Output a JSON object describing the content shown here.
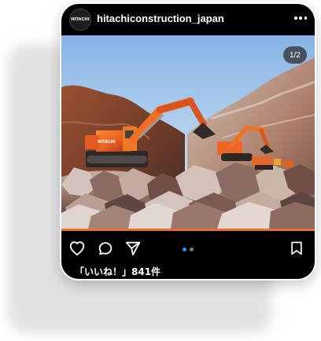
{
  "account": {
    "username": "hitachiconstruction_japan",
    "avatar_text": "HITACHI"
  },
  "photo": {
    "counter": "1/2",
    "subject": "orange excavators in a rocky quarry",
    "slide_count": 2,
    "active_slide": 1
  },
  "engagement": {
    "likes_text": "「いいね！」841件"
  },
  "colors": {
    "card_background": "#000000",
    "accent_orange": "#e7702f",
    "active_dot": "#2f93ff",
    "inactive_dot": "#7b7b7b",
    "text": "#ffffff"
  },
  "icons": {
    "more": "more-icon",
    "like": "heart-icon",
    "comment": "comment-icon",
    "share": "send-icon",
    "save": "bookmark-icon"
  }
}
